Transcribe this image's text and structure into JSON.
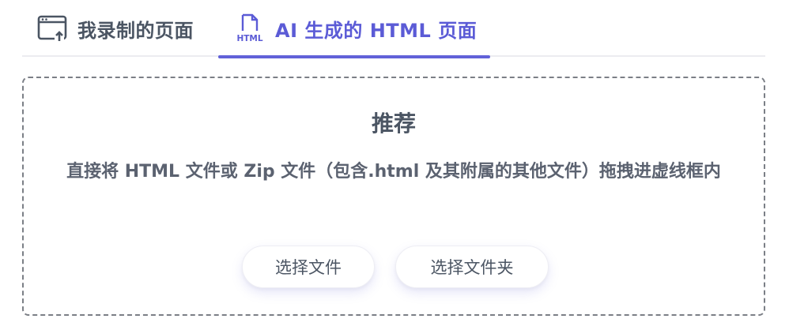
{
  "tabs": {
    "recorded": {
      "label": "我录制的页面",
      "icon": "browser-upload-icon"
    },
    "ai": {
      "label": "AI 生成的 HTML 页面",
      "icon": "html-file-icon",
      "icon_text": "HTML"
    }
  },
  "dropzone": {
    "title": "推荐",
    "description": "直接将 HTML 文件或 Zip 文件（包含.html 及其附属的其他文件）拖拽进虚线框内",
    "choose_file": "选择文件",
    "choose_folder": "选择文件夹"
  },
  "colors": {
    "accent": "#5b5bd6",
    "text": "#4b5563",
    "border_dashed": "#7b7f86"
  }
}
